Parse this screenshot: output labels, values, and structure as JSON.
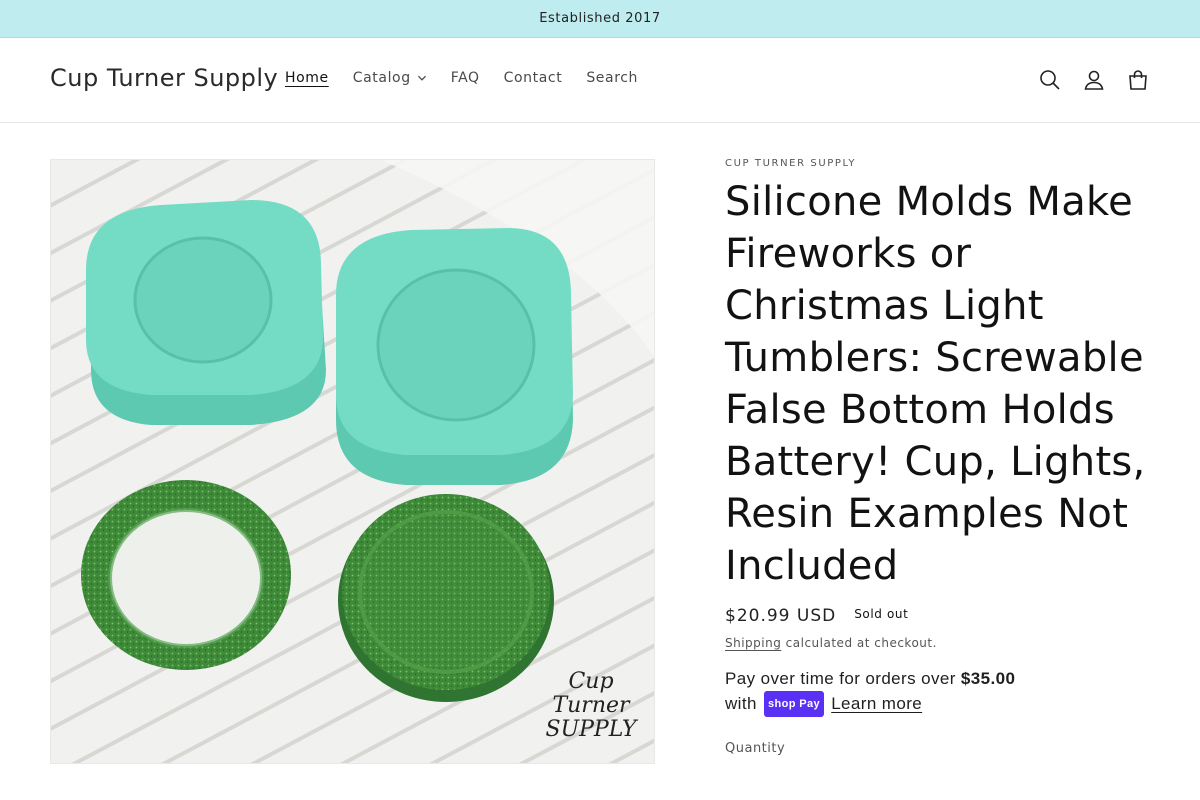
{
  "announcement": {
    "text": "Established 2017"
  },
  "header": {
    "logo": "Cup Turner Supply",
    "nav": [
      {
        "label": "Home",
        "active": true
      },
      {
        "label": "Catalog",
        "has_dropdown": true
      },
      {
        "label": "FAQ"
      },
      {
        "label": "Contact"
      },
      {
        "label": "Search"
      }
    ],
    "icons": [
      "search-icon",
      "account-icon",
      "cart-icon"
    ]
  },
  "product": {
    "image_watermark": "Cup Turner SUPPLY",
    "vendor": "CUP TURNER SUPPLY",
    "title": "Silicone Molds Make Fireworks or Christmas Light Tumblers: Screwable False Bottom Holds Battery! Cup, Lights, Resin Examples Not Included",
    "price": "$20.99 USD",
    "badge": "Sold out",
    "shipping_link": "Shipping",
    "shipping_rest": " calculated at checkout.",
    "installments": {
      "prefix": "Pay over time for orders over ",
      "amount": "$35.00",
      "with": "with",
      "shop_pay": "shop Pay",
      "learn_more": "Learn more"
    },
    "quantity_label": "Quantity"
  },
  "colors": {
    "announcement_bg": "#bfecef",
    "mold_teal": "#6fd8c0",
    "glitter_green": "#3f8f3a",
    "shop_pay_purple": "#5a31f4"
  }
}
